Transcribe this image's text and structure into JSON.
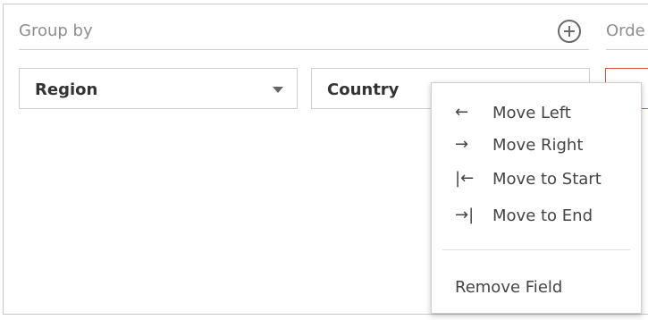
{
  "group_by": {
    "label": "Group by",
    "add_icon": "plus-circle-icon",
    "fields": [
      {
        "label": "Region",
        "icon": "chevron-down-icon"
      },
      {
        "label": "Country"
      }
    ]
  },
  "order_by": {
    "label": "Orde"
  },
  "context_menu": {
    "items": [
      {
        "glyph": "←",
        "icon": "arrow-left-icon",
        "label": "Move Left"
      },
      {
        "glyph": "→",
        "icon": "arrow-right-icon",
        "label": "Move Right"
      },
      {
        "glyph": "|←",
        "icon": "arrow-to-start-icon",
        "label": "Move to Start"
      },
      {
        "glyph": "→|",
        "icon": "arrow-to-end-icon",
        "label": "Move to End"
      }
    ],
    "remove_label": "Remove Field"
  },
  "colors": {
    "border": "#c8c8c8",
    "muted_text": "#8e8e8e",
    "order_pill_border": "#d9534f"
  }
}
